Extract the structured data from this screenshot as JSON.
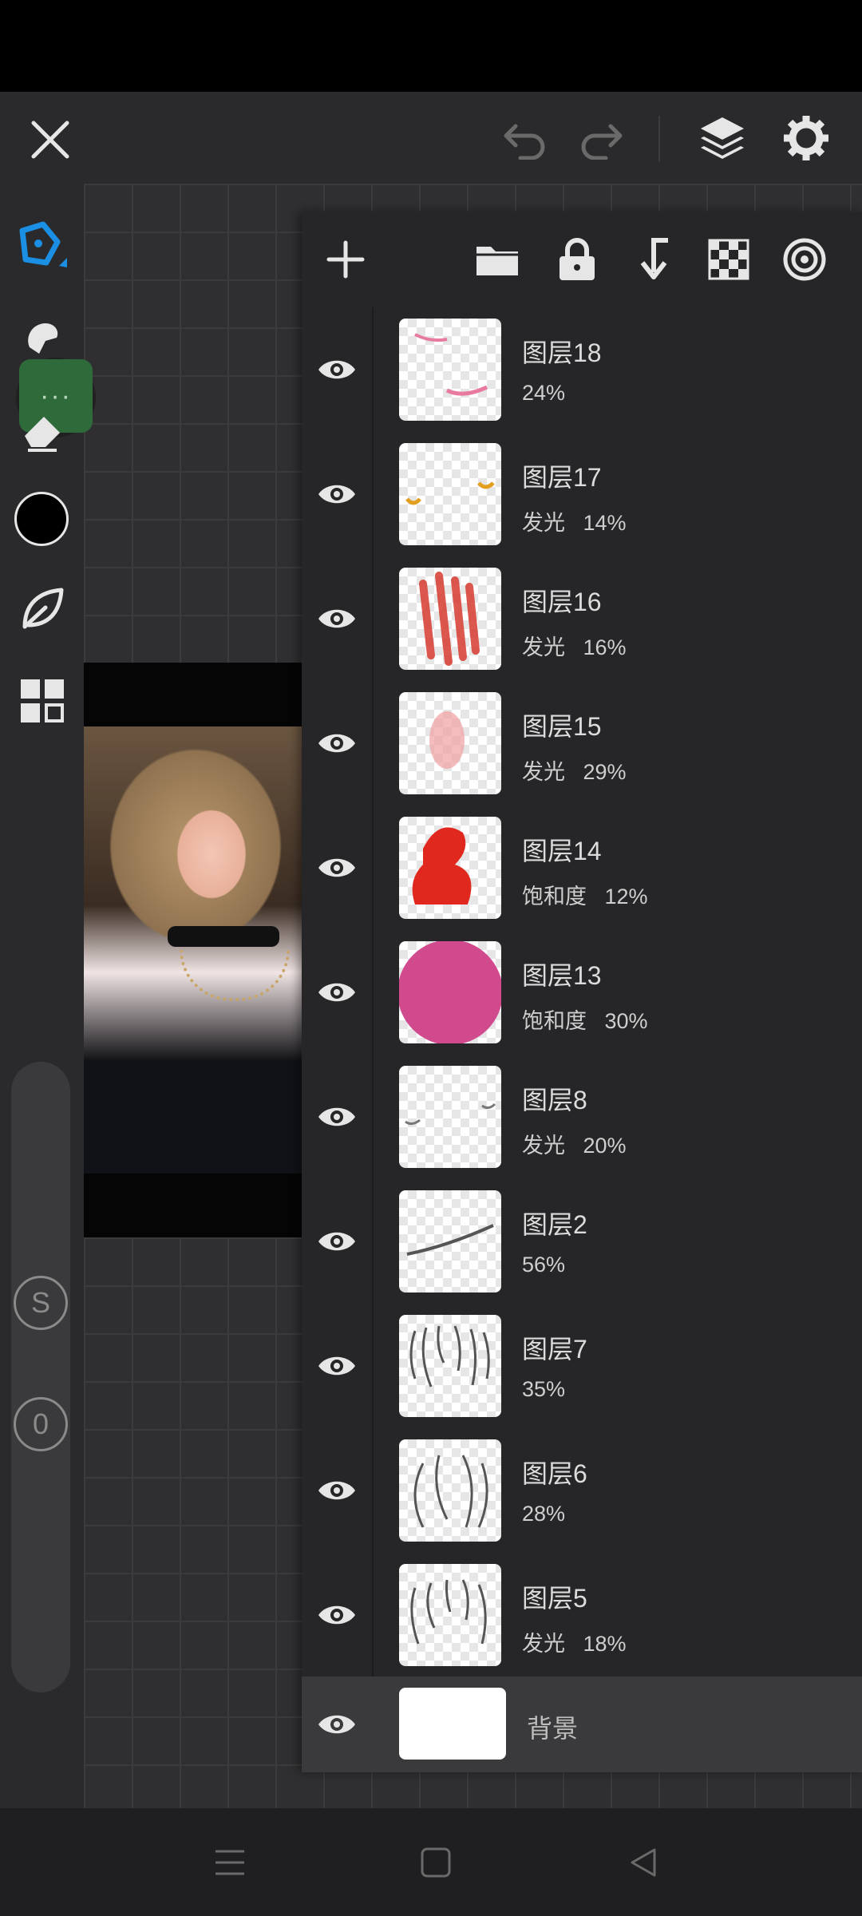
{
  "colors": {
    "accent": "#1a8fe3",
    "panel": "#262628",
    "bg_row": "#3a3a3c"
  },
  "topbar": {
    "close_icon": "close-icon",
    "undo_icon": "undo-icon",
    "redo_icon": "redo-icon",
    "layers_icon": "layers-icon",
    "settings_icon": "gear-icon"
  },
  "tools": {
    "pen": "pen-icon",
    "smudge": "smudge-icon",
    "eraser": "eraser-icon",
    "color": "#000000",
    "leaf": "leaf-icon",
    "grid": "grid-icon",
    "symmetry_label": "S",
    "opacity_label": "0"
  },
  "layer_toolbar": [
    "add-layer",
    "folder",
    "lock",
    "merge-down",
    "transparency",
    "blend"
  ],
  "layers": [
    {
      "name": "图层18",
      "meta": "24%"
    },
    {
      "name": "图层17",
      "meta": "发光   14%"
    },
    {
      "name": "图层16",
      "meta": "发光   16%"
    },
    {
      "name": "图层15",
      "meta": "发光   29%"
    },
    {
      "name": "图层14",
      "meta": "饱和度   12%"
    },
    {
      "name": "图层13",
      "meta": "饱和度   30%"
    },
    {
      "name": "图层8",
      "meta": "发光   20%"
    },
    {
      "name": "图层2",
      "meta": "56%"
    },
    {
      "name": "图层7",
      "meta": "35%"
    },
    {
      "name": "图层6",
      "meta": "28%"
    },
    {
      "name": "图层5",
      "meta": "发光   18%"
    }
  ],
  "background_layer": {
    "name": "背景"
  }
}
